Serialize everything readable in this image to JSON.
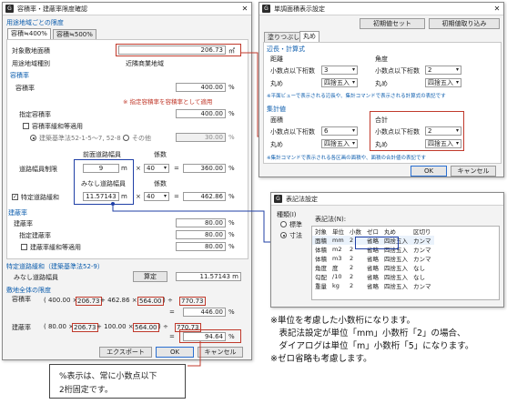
{
  "main": {
    "title": "容積率・建蔽率限度確認",
    "sec_per_zone": "用途地域ごとの限度",
    "tabs": [
      "容積≒400%",
      "容積≒500%"
    ],
    "site_area_label": "対象敷地面積",
    "site_area_value": "206.73",
    "site_area_unit": "㎡",
    "zone_label": "用途地域種別",
    "zone_value": "近隣商業地域",
    "far_section": "容積率",
    "far_label": "容積率",
    "far_value": "400.00",
    "pct": "%",
    "designated_note": "※ 指定容積率を容積率として適用",
    "designated_label": "指定容積率",
    "designated_value": "400.00",
    "relax_label": "容積率緩和等適用",
    "bsl_option": "建築基準法52-1-5〜7, 52-8",
    "other_option": "その他",
    "relax_value": "30.00",
    "front_road_hdr": "前面道路幅員",
    "coef_hdr": "係数",
    "road_width_label": "道路幅員制限",
    "road_width_value": "9",
    "m_unit": "m",
    "coef_value": "40",
    "road_result": "360.00",
    "deemed_road_hdr": "みなし道路幅員",
    "coef_hdr2": "係数",
    "special_road_label": "特定道路緩和",
    "special_road_value": "11.57143",
    "coef_value2": "40",
    "special_result": "462.86",
    "bcr_section": "建蔽率",
    "bcr_label": "建蔽率",
    "bcr_value": "80.00",
    "designated_bcr_label": "指定建蔽率",
    "designated_bcr_value": "80.00",
    "bcr_relax_label": "建蔽率緩和等適用",
    "bcr_relax_value": "80.00",
    "special_section": "特定道路緩和（建築基準法52-9）",
    "deemed_label": "みなし道路幅員",
    "calc_button": "算定",
    "deemed_value": "11.57143 m",
    "total_section": "敷地全体の限度",
    "total_far_label": "容積率",
    "far_formula": [
      "( 400.00 ×",
      "206.73",
      "+ 462.86 ×",
      "564.00",
      ") ÷",
      "770.73"
    ],
    "far_total": "446.00",
    "total_bcr_label": "建蔽率",
    "bcr_formula": [
      "( 80.00 ×",
      "206.73",
      "+ 100.00 ×",
      "564.00",
      ") ÷",
      "770.73"
    ],
    "bcr_total": "94.64",
    "export_button": "エクスポート",
    "ok_button": "OK",
    "cancel_button": "キャンセル"
  },
  "unit_dialog": {
    "title": "単調面積表示設定",
    "reset_button": "初期値セット",
    "load_button": "初期値取り込み",
    "tabs": [
      "塗りつぶし",
      "丸め"
    ],
    "side_section": "辺長・計算式",
    "dist_label": "距離",
    "angle_label": "角度",
    "decimals_label": "小数点以下桁数",
    "dist_decimals": "3",
    "angle_decimals": "2",
    "round_label": "丸め",
    "round_value": "四捨五入",
    "note1": "※平面ビューで表示される辺長や、集計コマンドで表示される計算式の表記です",
    "agg_section": "集計値",
    "area_label": "面積",
    "total_label": "合計",
    "area_decimals": "6",
    "total_decimals": "2",
    "note2": "※集計コマンドで表示される各区画の面積や、面積の合計値の表記です",
    "ok_button": "OK",
    "cancel_button": "キャンセル"
  },
  "notation_dialog": {
    "title": "表記法設定",
    "type_label": "種類(I)",
    "std_option": "標準",
    "dim_option": "寸法",
    "notation_label": "表記法(N):",
    "columns": [
      "対象",
      "単位",
      "小数",
      "ゼロ",
      "丸め",
      "区切り"
    ],
    "rows": [
      [
        "面積",
        "mm",
        "2",
        "省略",
        "四捨五入",
        "カンマ"
      ],
      [
        "体積",
        "m2",
        "2",
        "省略",
        "四捨五入",
        "カンマ"
      ],
      [
        "体積",
        "m3",
        "2",
        "省略",
        "四捨五入",
        "カンマ"
      ],
      [
        "角度",
        "度",
        "2",
        "省略",
        "四捨五入",
        "なし"
      ],
      [
        "勾配",
        "/10",
        "2",
        "省略",
        "四捨五入",
        "なし"
      ],
      [
        "重量",
        "kg",
        "2",
        "省略",
        "四捨五入",
        "カンマ"
      ]
    ]
  },
  "callout": {
    "lines": [
      "%表示は、常に小数点以下",
      "2桁固定です。"
    ]
  },
  "notes": {
    "lines": [
      "※単位を考慮した小数桁になります。",
      "　表記法設定が単位「mm」小数桁「2」の場合、",
      "　ダイアログは単位「m」小数桁「5」になります。",
      "※ゼロ省略も考慮します。"
    ]
  },
  "colors": {
    "accent_red": "#c0392b",
    "accent_blue": "#1f3fa6",
    "section_blue": "#0b5cad"
  }
}
